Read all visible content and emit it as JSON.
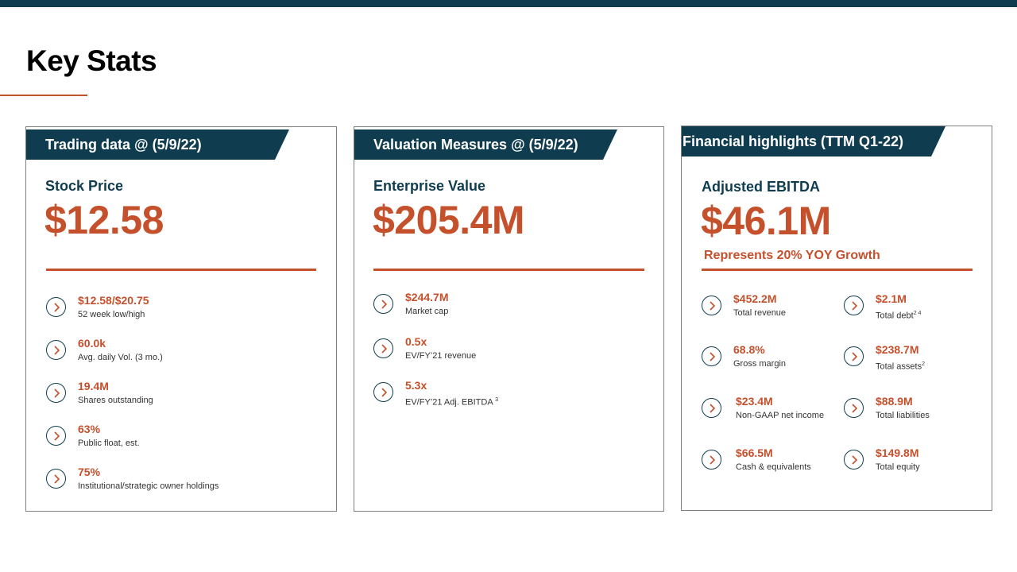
{
  "page": {
    "title": "Key Stats"
  },
  "cards": [
    {
      "header": "Trading data @ (5/9/22)",
      "label": "Stock Price",
      "value": "$12.58",
      "stats": [
        {
          "value": "$12.58/$20.75",
          "desc": "52 week low/high"
        },
        {
          "value": "60.0k",
          "desc": "Avg. daily Vol. (3 mo.)"
        },
        {
          "value": "19.4M",
          "desc": "Shares outstanding"
        },
        {
          "value": "63%",
          "desc": "Public float, est."
        },
        {
          "value": "75%",
          "desc": "Institutional/strategic owner holdings"
        }
      ]
    },
    {
      "header": "Valuation Measures @ (5/9/22)",
      "label": "Enterprise Value",
      "value": "$205.4M",
      "stats": [
        {
          "value": "$244.7M",
          "desc": "Market cap"
        },
        {
          "value": "0.5x",
          "desc": "EV/FY’21 revenue"
        },
        {
          "value": "5.3x",
          "desc": "EV/FY’21 Adj. EBITDA",
          "sup": "3"
        }
      ]
    },
    {
      "header": "Financial highlights (TTM Q1-22)",
      "label": "Adjusted EBITDA",
      "value": "$46.1M",
      "subtitle": "Represents 20% YOY Growth",
      "stats": [
        {
          "value": "$452.2M",
          "desc": "Total revenue"
        },
        {
          "value": "$2.1M",
          "desc": "Total debt",
          "sup": "2 4"
        },
        {
          "value": "68.8%",
          "desc": "Gross margin"
        },
        {
          "value": "$238.7M",
          "desc": "Total assets",
          "sup": "2"
        },
        {
          "value": "$23.4M",
          "desc": "Non-GAAP net income"
        },
        {
          "value": "$88.9M",
          "desc": "Total liabilities"
        },
        {
          "value": "$66.5M",
          "desc": "Cash & equivalents"
        },
        {
          "value": "$149.8M",
          "desc": "Total equity"
        }
      ]
    }
  ],
  "colors": {
    "navy": "#0f3d4f",
    "accent": "#c4502c"
  },
  "icons": {
    "stat_bullet": "chevron-right-circle-icon"
  }
}
